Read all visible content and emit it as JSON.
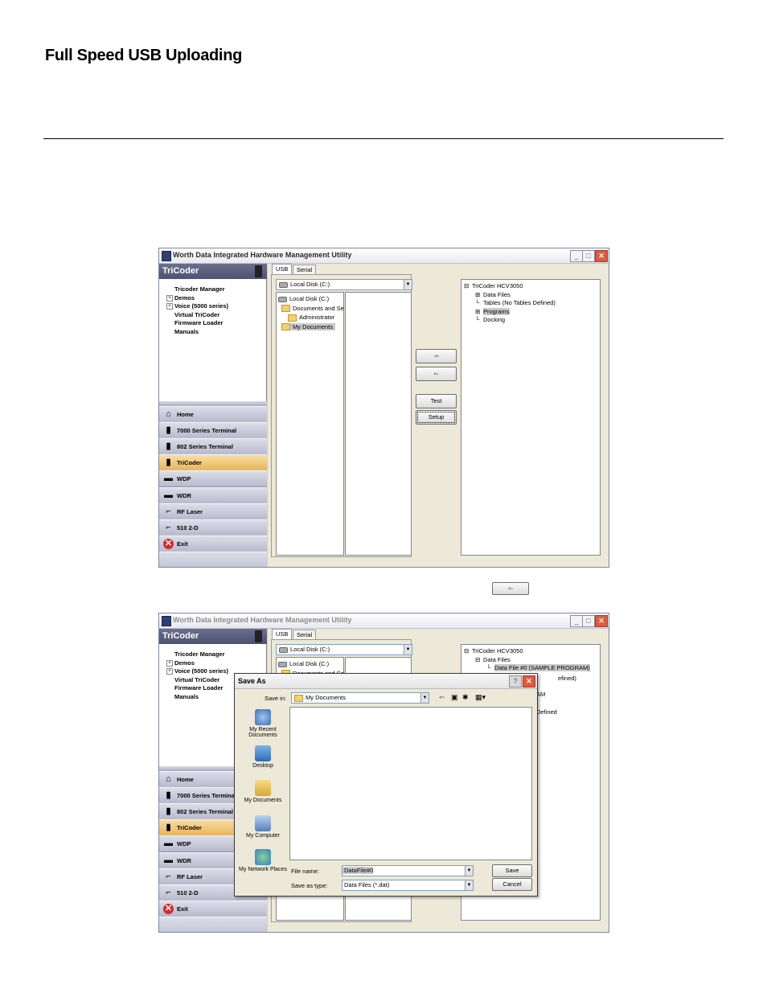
{
  "doc": {
    "heading": "Full Speed USB Uploading"
  },
  "app": {
    "title": "Worth Data Integrated Hardware Management Utility",
    "left_header": "TriCoder",
    "tree": [
      {
        "label": "Tricoder Manager",
        "expandable": false
      },
      {
        "label": "Demos",
        "expandable": true
      },
      {
        "label": "Voice (5000 series)",
        "expandable": true
      },
      {
        "label": "Virtual TriCoder",
        "expandable": false
      },
      {
        "label": "Firmware Loader",
        "expandable": false
      },
      {
        "label": "Manuals",
        "expandable": false
      }
    ],
    "nav": [
      {
        "label": "Home",
        "icon": "home-icon",
        "glyph": "⌂"
      },
      {
        "label": "7000 Series Terminal",
        "icon": "terminal-icon",
        "glyph": "▮"
      },
      {
        "label": "802 Series Terminal",
        "icon": "terminal-icon",
        "glyph": "▮"
      },
      {
        "label": "TriCoder",
        "icon": "tricoder-icon",
        "glyph": "▮",
        "selected": true
      },
      {
        "label": "WDP",
        "icon": "wand-icon",
        "glyph": "▬"
      },
      {
        "label": "WDR",
        "icon": "wand-icon",
        "glyph": "▬"
      },
      {
        "label": "RF Laser",
        "icon": "scanner-gun-icon",
        "glyph": "⌐"
      },
      {
        "label": "510 2-D",
        "icon": "scanner-gun-icon",
        "glyph": "⌐"
      },
      {
        "label": "Exit",
        "icon": "exit-icon",
        "glyph": "✕"
      }
    ],
    "tabs": [
      "USB",
      "Serial"
    ],
    "drive_combo": "Local Disk (C:)",
    "folders": [
      "Local Disk (C:)",
      "Documents and Se",
      "Administrator",
      "My Documents"
    ],
    "buttons": {
      "upload": "⇒",
      "download": "⇐",
      "test": "Test",
      "setup": "Setup"
    },
    "device_tree_1": [
      {
        "label": "TriCoder HCV3050",
        "level": 0,
        "sign": "⊟"
      },
      {
        "label": "Data Files",
        "level": 1,
        "sign": "⊞"
      },
      {
        "label": "Tables (No Tables Defined)",
        "level": 1,
        "sign": ""
      },
      {
        "label": "Programs",
        "level": 1,
        "sign": "⊞",
        "highlight": true
      },
      {
        "label": "Docking",
        "level": 1,
        "sign": ""
      }
    ],
    "device_tree_2": [
      {
        "label": "TriCoder HCV3050",
        "level": 0,
        "sign": "⊟"
      },
      {
        "label": "Data Files",
        "level": 1,
        "sign": "⊟"
      },
      {
        "label": "Data File #0 (SAMPLE PROGRAM)",
        "level": 2,
        "sign": "",
        "highlight": true
      }
    ],
    "peek": [
      "efined)",
      "AM",
      "Defined"
    ]
  },
  "inline_button": "⇐",
  "save_as": {
    "title": "Save As",
    "save_in_label": "Save in:",
    "save_in_value": "My Documents",
    "places": [
      "My Recent Documents",
      "Desktop",
      "My Documents",
      "My Computer",
      "My Network Places"
    ],
    "file_name_label": "File name:",
    "file_name_value": "DataFile#0",
    "save_type_label": "Save as type:",
    "save_type_value": "Data Files (*.dat)",
    "save_button": "Save",
    "cancel_button": "Cancel",
    "help_glyph": "?",
    "close_glyph": "✕"
  }
}
